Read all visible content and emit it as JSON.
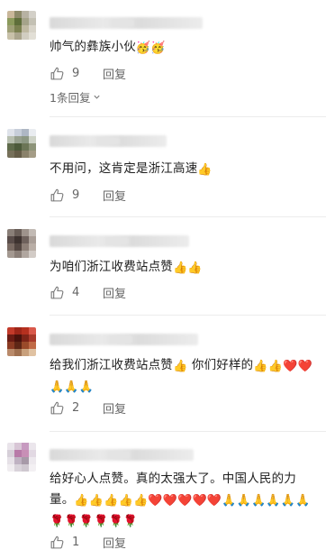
{
  "comments": [
    {
      "text_main": "帅气的彝族小伙",
      "text_emoji": "🥳🥳",
      "likes": "9",
      "reply_label": "回复",
      "more_replies": "1条回复"
    },
    {
      "text_main": "不用问，这肯定是浙江高速",
      "text_emoji": "👍",
      "likes": "9",
      "reply_label": "回复"
    },
    {
      "text_main": "为咱们浙江收费站点赞",
      "text_emoji": "👍👍",
      "likes": "4",
      "reply_label": "回复"
    },
    {
      "text_line1": "给我们浙江收费站点赞",
      "text_line1_emoji": "👍",
      "text_line1_b": " 你们好样的",
      "text_line1_emoji_b": "👍👍❤️❤️",
      "text_line2_emoji": "🙏🙏🙏",
      "likes": "2",
      "reply_label": "回复"
    },
    {
      "text_line1": "给好心人点赞。真的太强大了。中国人民的力",
      "text_line2": "量。",
      "text_line2_emoji": "👍👍👍👍👍❤️❤️❤️❤️❤️🙏🙏🙏🙏🙏🙏",
      "text_line3_emoji": "🌹🌹🌹🌹🌹🌹",
      "likes": "1",
      "reply_label": "回复"
    }
  ],
  "colors": {
    "text": "#1f1f1f",
    "muted": "#666666",
    "divider": "#ececec"
  },
  "icons": {
    "like": "thumbs-up-outline-icon",
    "chevron": "chevron-down-icon"
  }
}
